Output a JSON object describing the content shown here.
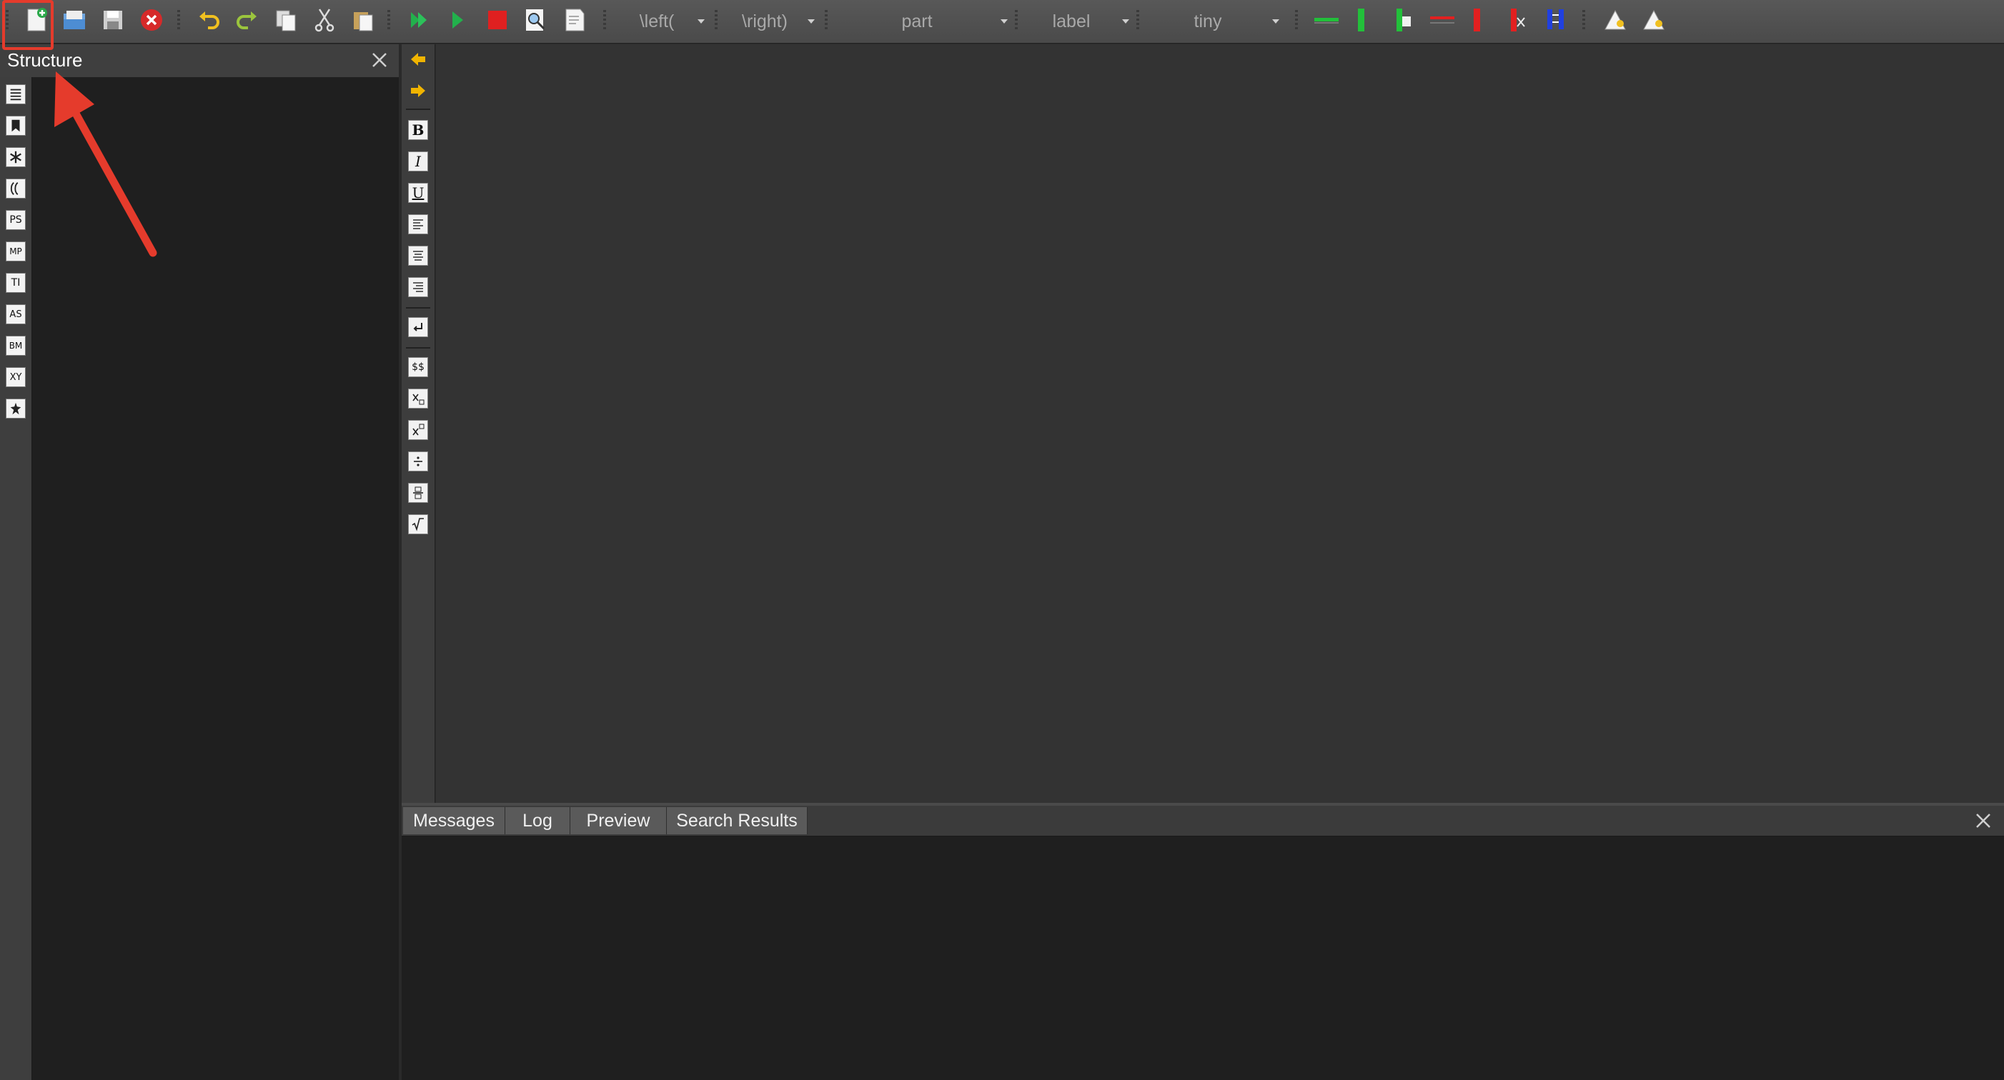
{
  "toolbar": {
    "combos": {
      "left_delim": "\\left(",
      "right_delim": "\\right)",
      "sectioning": "part",
      "reference": "label",
      "size": "tiny"
    }
  },
  "structure_panel": {
    "title": "Structure",
    "strip_icons": [
      "PS",
      "MP",
      "TI",
      "AS",
      "BM",
      "XY"
    ]
  },
  "edit_toolbar": {
    "bold": "B",
    "italic": "I",
    "underline": "U",
    "math": "$$"
  },
  "messages_dock": {
    "tabs": [
      "Messages",
      "Log",
      "Preview",
      "Search Results"
    ]
  },
  "colors": {
    "highlight": "#e53b2c",
    "run_green": "#22b14c",
    "stop_red": "#e02020"
  }
}
